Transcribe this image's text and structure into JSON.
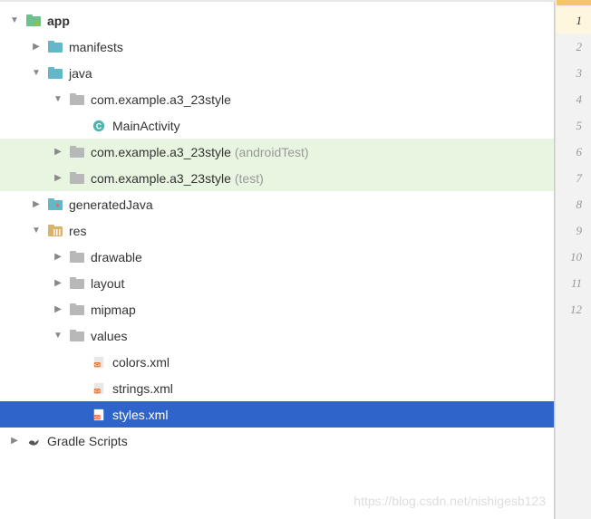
{
  "tree": {
    "items": [
      {
        "indent": 0,
        "arrow": "down",
        "icon": "module-folder",
        "label": "app",
        "bold": true
      },
      {
        "indent": 1,
        "arrow": "right",
        "icon": "folder-teal",
        "label": "manifests"
      },
      {
        "indent": 1,
        "arrow": "down",
        "icon": "folder-teal",
        "label": "java"
      },
      {
        "indent": 2,
        "arrow": "down",
        "icon": "package",
        "label": "com.example.a3_23style"
      },
      {
        "indent": 3,
        "arrow": "none",
        "icon": "class-c",
        "label": "MainActivity"
      },
      {
        "indent": 2,
        "arrow": "right",
        "icon": "package",
        "label": "com.example.a3_23style",
        "suffix": "(androidTest)",
        "highlight": "green"
      },
      {
        "indent": 2,
        "arrow": "right",
        "icon": "package",
        "label": "com.example.a3_23style",
        "suffix": "(test)",
        "highlight": "green"
      },
      {
        "indent": 1,
        "arrow": "right",
        "icon": "gen-folder",
        "label": "generatedJava"
      },
      {
        "indent": 1,
        "arrow": "down",
        "icon": "res-folder",
        "label": "res"
      },
      {
        "indent": 2,
        "arrow": "right",
        "icon": "package",
        "label": "drawable"
      },
      {
        "indent": 2,
        "arrow": "right",
        "icon": "package",
        "label": "layout"
      },
      {
        "indent": 2,
        "arrow": "right",
        "icon": "package",
        "label": "mipmap"
      },
      {
        "indent": 2,
        "arrow": "down",
        "icon": "package",
        "label": "values"
      },
      {
        "indent": 3,
        "arrow": "none",
        "icon": "xml",
        "label": "colors.xml"
      },
      {
        "indent": 3,
        "arrow": "none",
        "icon": "xml",
        "label": "strings.xml"
      },
      {
        "indent": 3,
        "arrow": "none",
        "icon": "xml",
        "label": "styles.xml",
        "selected": true
      },
      {
        "indent": 0,
        "arrow": "right",
        "icon": "gradle",
        "label": "Gradle Scripts"
      }
    ]
  },
  "gutter": {
    "lines": [
      1,
      2,
      3,
      4,
      5,
      6,
      7,
      8,
      9,
      10,
      11,
      12
    ],
    "current": 1
  },
  "watermark": "https://blog.csdn.net/nishigesb123"
}
